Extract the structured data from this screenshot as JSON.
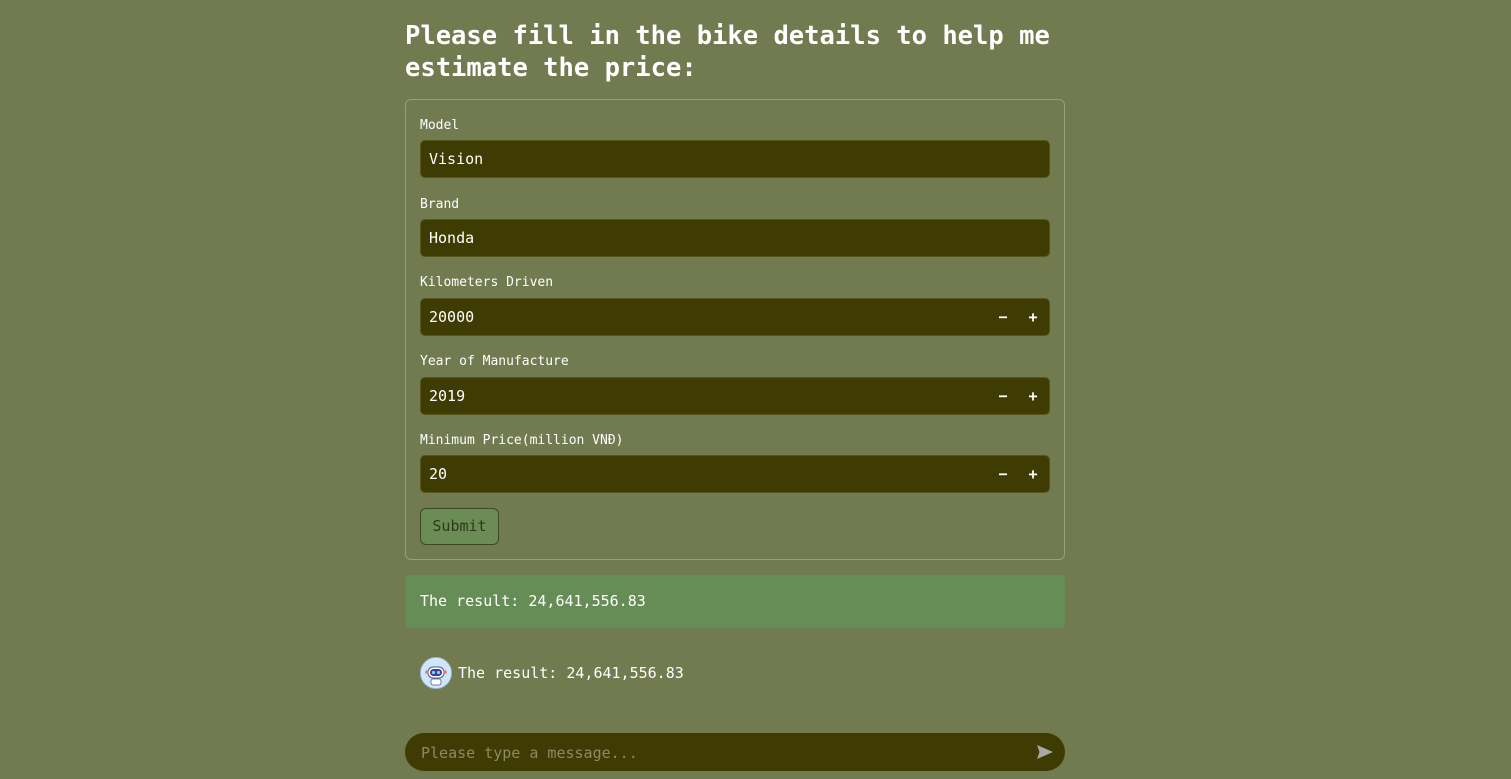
{
  "heading": "Please fill in the bike details to help me estimate the price:",
  "form": {
    "fields": [
      {
        "label": "Model",
        "value": "Vision",
        "stepper": false
      },
      {
        "label": "Brand",
        "value": "Honda",
        "stepper": false
      },
      {
        "label": "Kilometers Driven",
        "value": "20000",
        "stepper": true
      },
      {
        "label": "Year of Manufacture",
        "value": "2019",
        "stepper": true
      },
      {
        "label": "Minimum Price(million VNĐ)",
        "value": "20",
        "stepper": true
      }
    ],
    "stepper_minus": "−",
    "stepper_plus": "+",
    "submit_label": "Submit"
  },
  "result": {
    "text": "The result: 24,641,556.83"
  },
  "chat": {
    "messages": [
      {
        "icon": "robot-avatar-icon",
        "text": "The result: 24,641,556.83"
      }
    ]
  },
  "message_input": {
    "placeholder": "Please type a message...",
    "send_icon": "send-icon"
  },
  "colors": {
    "background": "#727a50",
    "input_background": "#3f3c03",
    "result_background": "#678d57",
    "text": "#ffffff"
  }
}
